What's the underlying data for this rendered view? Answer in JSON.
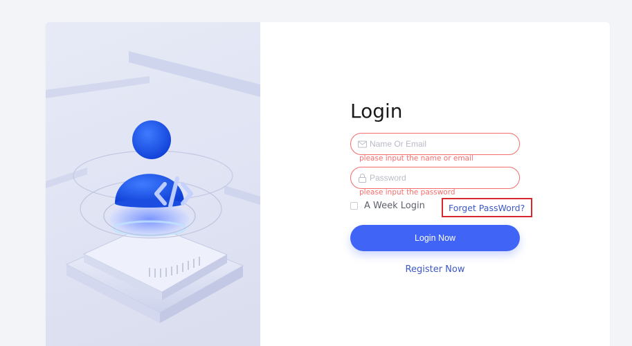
{
  "login": {
    "title": "Login",
    "username": {
      "placeholder": "Name Or Email",
      "value": "",
      "error": "please input the name or email",
      "icon": "mail-icon"
    },
    "password": {
      "placeholder": "Password",
      "value": "",
      "error": "please input the password",
      "icon": "lock-icon"
    },
    "remember": {
      "label": "A Week Login",
      "checked": false
    },
    "forget_label": "Forget PassWord?",
    "submit_label": "Login Now",
    "register_label": "Register Now"
  },
  "colors": {
    "primary": "#4065f6",
    "error": "#f56c6c",
    "link": "#3c57c7",
    "highlight_box": "#d6262e",
    "page_bg": "#f2f4f8"
  }
}
